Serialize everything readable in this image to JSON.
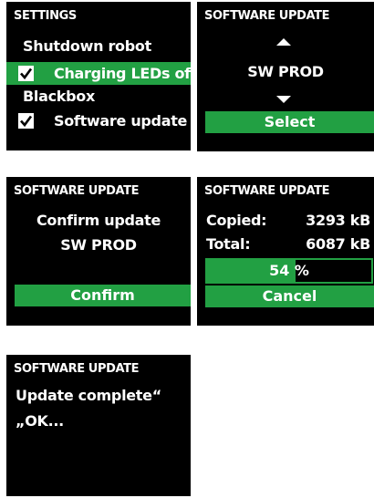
{
  "colors": {
    "accent": "#22a043",
    "screen_bg": "#000000",
    "text": "#ffffff"
  },
  "settings": {
    "header": "SETTINGS",
    "items": [
      {
        "label": "Shutdown robot",
        "checked": false,
        "selected": false
      },
      {
        "label": "Charging LEDs off",
        "checked": true,
        "selected": true
      },
      {
        "label": "Blackbox",
        "checked": false,
        "selected": false
      },
      {
        "label": "Software update",
        "checked": true,
        "selected": false
      }
    ]
  },
  "sw_select": {
    "header": "SOFTWARE UPDATE",
    "up_icon": "triangle-up-icon",
    "value": "SW PROD",
    "down_icon": "triangle-down-icon",
    "button": "Select"
  },
  "sw_confirm": {
    "header": "SOFTWARE UPDATE",
    "line1": "Confirm update",
    "line2": "SW PROD",
    "button": "Confirm"
  },
  "sw_progress": {
    "header": "SOFTWARE UPDATE",
    "copied_label": "Copied:",
    "copied_value": "3293 kB",
    "total_label": "Total:",
    "total_value": "6087 kB",
    "percent": "54",
    "percent_sign": "%",
    "progress_fraction": 0.54,
    "button": "Cancel"
  },
  "sw_complete": {
    "header": "SOFTWARE UPDATE",
    "line1": "Update complete“",
    "line2": "„OK..."
  }
}
